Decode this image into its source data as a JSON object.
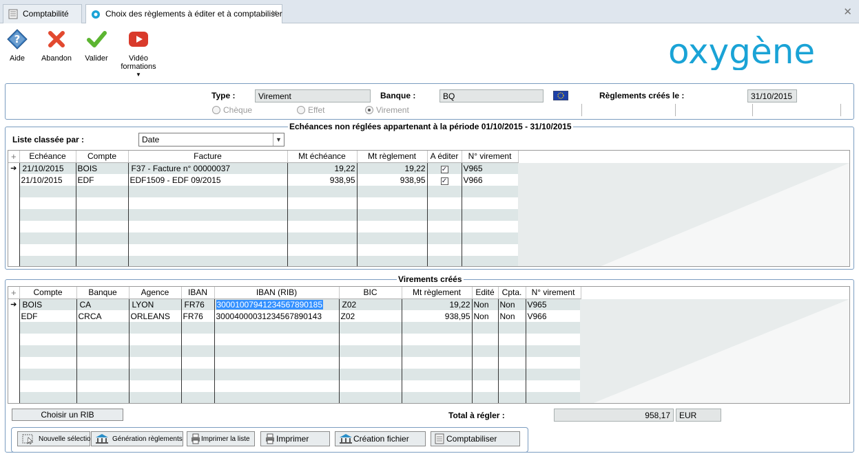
{
  "tabs": [
    {
      "label": "Comptabilité"
    },
    {
      "label": "Choix des règlements à éditer et à comptabiliser"
    }
  ],
  "toolbar": {
    "aide": "Aide",
    "abandon": "Abandon",
    "valider": "Valider",
    "video_line1": "Vidéo",
    "video_line2": "formations"
  },
  "logo_text": "oxygène",
  "header": {
    "type_label": "Type :",
    "type_value": "Virement",
    "banque_label": "Banque :",
    "banque_value": "BQ",
    "reglements_label": "Règlements créés le :",
    "reglements_value": "31/10/2015",
    "radios": [
      {
        "label": "Chèque",
        "checked": false
      },
      {
        "label": "Effet",
        "checked": false
      },
      {
        "label": "Virement",
        "checked": true
      }
    ]
  },
  "echeances": {
    "legend": "Echéances non réglées appartenant à la période 01/10/2015 - 31/10/2015",
    "sort_label": "Liste classée par :",
    "sort_value": "Date",
    "columns": [
      "Echéance",
      "Compte",
      "Facture",
      "Mt échéance",
      "Mt règlement",
      "A éditer",
      "N° virement"
    ],
    "rows": [
      {
        "echeance": "21/10/2015",
        "compte": "BOIS",
        "facture": "F37 - Facture n° 00000037",
        "mt_echeance": "19,22",
        "mt_reglement": "19,22",
        "a_editer": true,
        "virement": "V965"
      },
      {
        "echeance": "21/10/2015",
        "compte": "EDF",
        "facture": "EDF1509 - EDF 09/2015",
        "mt_echeance": "938,95",
        "mt_reglement": "938,95",
        "a_editer": true,
        "virement": "V966"
      }
    ]
  },
  "virements": {
    "legend": "Virements créés",
    "columns": [
      "Compte",
      "Banque",
      "Agence",
      "IBAN",
      "IBAN (RIB)",
      "BIC",
      "Mt règlement",
      "Edité",
      "Cpta.",
      "N° virement"
    ],
    "rows": [
      {
        "compte": "BOIS",
        "banque": "CA",
        "agence": "LYON",
        "iban": "FR76",
        "rib": "30001007941234567890185",
        "bic": "Z02",
        "mt": "19,22",
        "edite": "Non",
        "cpta": "Non",
        "virement": "V965"
      },
      {
        "compte": "EDF",
        "banque": "CRCA",
        "agence": "ORLEANS",
        "iban": "FR76",
        "rib": "30004000031234567890143",
        "bic": "Z02",
        "mt": "938,95",
        "edite": "Non",
        "cpta": "Non",
        "virement": "V966"
      }
    ],
    "choisir_rib": "Choisir un RIB",
    "total_label": "Total à régler :",
    "total_value": "958,17",
    "currency": "EUR"
  },
  "actions": {
    "nouvelle_selection": "Nouvelle sélection",
    "generation": "Génération règlements",
    "imprimer_liste": "Imprimer la liste",
    "imprimer": "Imprimer",
    "creation_fichier": "Création fichier",
    "comptabiliser": "Comptabiliser"
  },
  "colors": {
    "accent": "#1aa3d6",
    "grid_alt": "#dde6e6",
    "panel_border": "#7a9cc0",
    "selection": "#3390ff"
  }
}
